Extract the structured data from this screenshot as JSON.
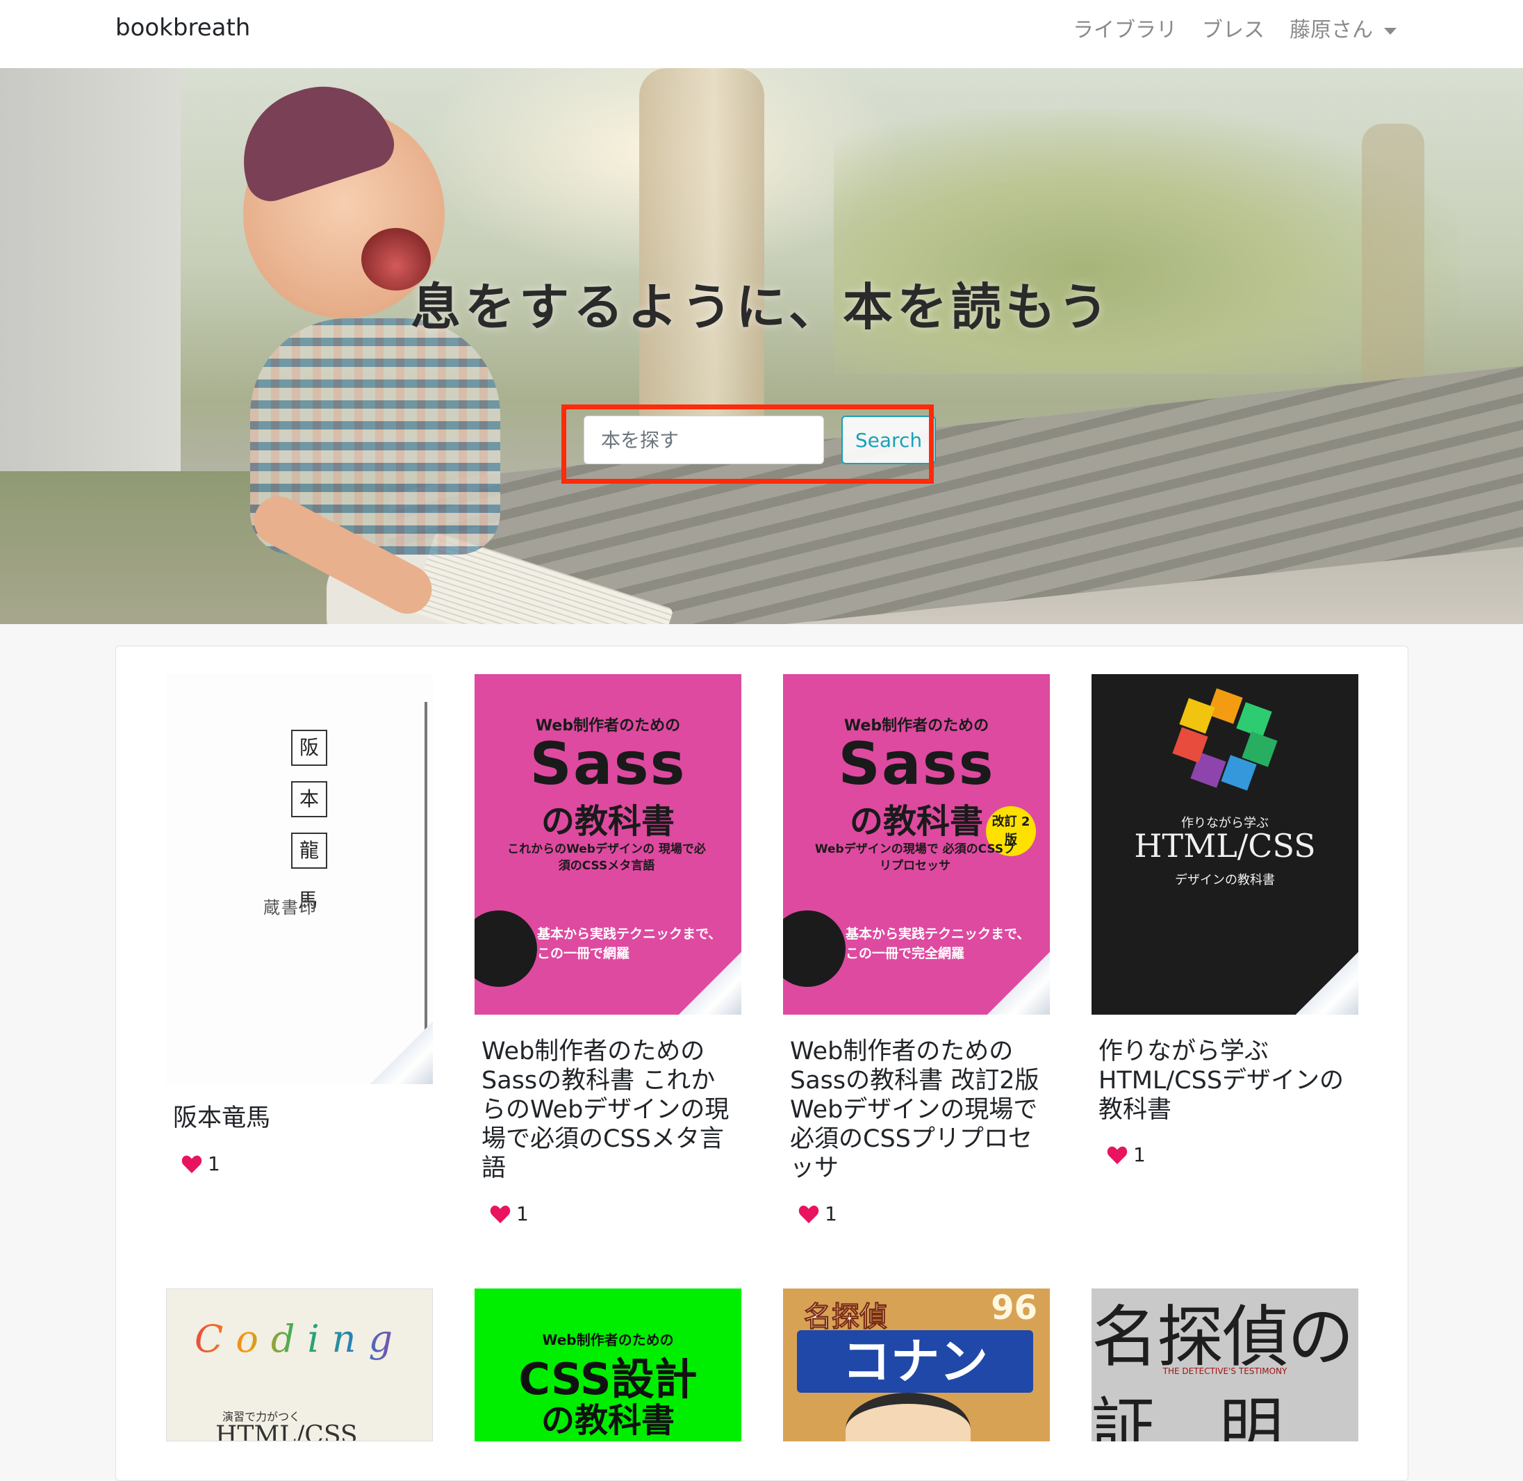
{
  "navbar": {
    "brand": "bookbreath",
    "links": [
      "ライブラリ",
      "ブレス"
    ],
    "user_menu": "藤原さん"
  },
  "hero": {
    "title": "息をするように、本を読もう",
    "search": {
      "placeholder": "本を探す",
      "value": "",
      "button_label": "Search"
    },
    "highlight_color": "#ff2a0a"
  },
  "books": [
    {
      "title": "阪本竜馬",
      "likes": "1",
      "cover": {
        "chars": [
          "阪",
          "本",
          "龍",
          "馬"
        ],
        "stamp": "蔵書印"
      }
    },
    {
      "title": "Web制作者のための Sassの教科書 これからのWebデザインの現場で必須のCSSメタ言語",
      "likes": "1",
      "cover": {
        "small": "Web制作者のための",
        "big": "Sass",
        "mid": "の教科書",
        "sub": "これからのWebデザインの 現場で必須のCSSメタ言語",
        "band": "基本から実践テクニックまで、この一冊で網羅"
      }
    },
    {
      "title": "Web制作者のための Sassの教科書 改訂2版 Webデザインの現場で必須のCSSプリプロセッサ",
      "likes": "1",
      "cover": {
        "small": "Web制作者のための",
        "big": "Sass",
        "mid": "の教科書",
        "sub": "Webデザインの現場で 必須のCSSプリプロセッサ",
        "badge": "改訂 2版",
        "band": "基本から実践テクニックまで、この一冊で完全網羅"
      }
    },
    {
      "title": "作りながら学ぶ HTML/CSSデザインの教科書",
      "likes": "1",
      "cover": {
        "small": "作りながら学ぶ",
        "big": "HTML/CSS",
        "sub": "デザインの教科書"
      }
    },
    {
      "cover": {
        "word": "Coding",
        "sub": "演習で力がつく",
        "big": "HTML/CSS"
      }
    },
    {
      "cover": {
        "small": "Web制作者のための",
        "big": "CSS設計",
        "mid": "の教科書"
      }
    },
    {
      "cover": {
        "title": "名探偵",
        "vol": "96",
        "logo": "コナン"
      }
    },
    {
      "cover": {
        "top": "名探偵の",
        "ribbon": "THE DETECTIVE'S TESTIMONY",
        "bottom": "証　明"
      }
    }
  ],
  "colors": {
    "heart": "#e8145f",
    "accent": "#17a2b8"
  }
}
